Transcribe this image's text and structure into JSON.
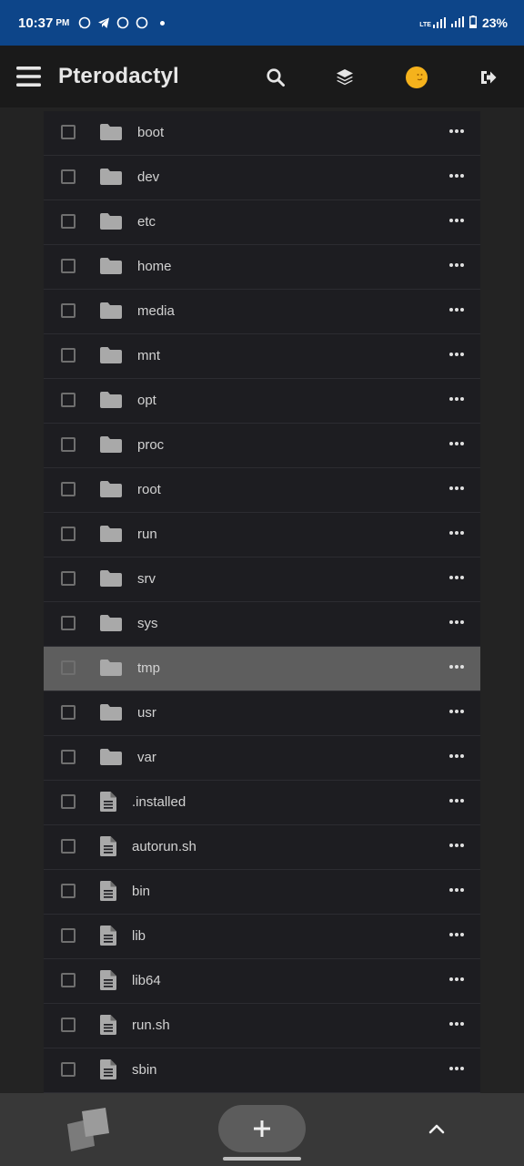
{
  "status_bar": {
    "time": "10:37",
    "ampm": "PM",
    "network": "LTE",
    "battery": "23%"
  },
  "app_bar": {
    "title": "Pterodactyl",
    "icons": [
      "menu-icon",
      "search-icon",
      "layers-icon",
      "avatar",
      "logout-icon"
    ]
  },
  "files": [
    {
      "name": "boot",
      "type": "folder"
    },
    {
      "name": "dev",
      "type": "folder"
    },
    {
      "name": "etc",
      "type": "folder"
    },
    {
      "name": "home",
      "type": "folder"
    },
    {
      "name": "media",
      "type": "folder"
    },
    {
      "name": "mnt",
      "type": "folder"
    },
    {
      "name": "opt",
      "type": "folder"
    },
    {
      "name": "proc",
      "type": "folder"
    },
    {
      "name": "root",
      "type": "folder"
    },
    {
      "name": "run",
      "type": "folder"
    },
    {
      "name": "srv",
      "type": "folder"
    },
    {
      "name": "sys",
      "type": "folder"
    },
    {
      "name": "tmp",
      "type": "folder",
      "highlighted": true
    },
    {
      "name": "usr",
      "type": "folder"
    },
    {
      "name": "var",
      "type": "folder"
    },
    {
      "name": ".installed",
      "type": "file"
    },
    {
      "name": "autorun.sh",
      "type": "file"
    },
    {
      "name": "bin",
      "type": "file"
    },
    {
      "name": "lib",
      "type": "file"
    },
    {
      "name": "lib64",
      "type": "file"
    },
    {
      "name": "run.sh",
      "type": "file"
    },
    {
      "name": "sbin",
      "type": "file"
    }
  ],
  "bottom_bar": {
    "icons": [
      "app-logo",
      "add-icon",
      "chevron-up-icon"
    ]
  },
  "colors": {
    "status_bar": "#0d4589",
    "app_bar": "#1a1a1a",
    "list_bg": "#1d1d21",
    "highlight_row": "#5e5e5e",
    "avatar": "#f5b21c"
  }
}
